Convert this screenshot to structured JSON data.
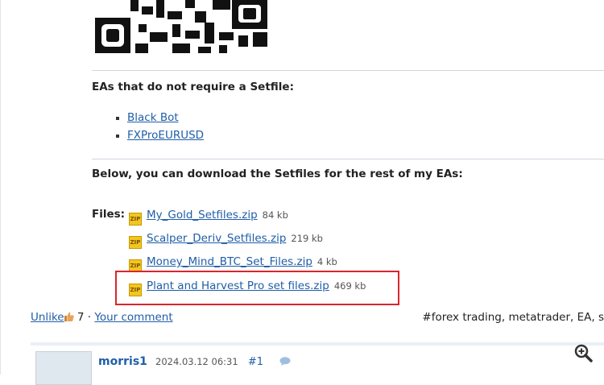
{
  "section_heading_1": "EAs that do not require a Setfile:",
  "no_setfile_eas": [
    "Black Bot",
    "FXProEURUSD"
  ],
  "section_heading_2": "Below, you can download the Setfiles for the rest of my EAs:",
  "files_label": "Files:",
  "files": [
    {
      "name": "My_Gold_Setfiles.zip",
      "size": "84 kb"
    },
    {
      "name": "Scalper_Deriv_Setfiles.zip",
      "size": "219 kb"
    },
    {
      "name": "Money_Mind_BTC_Set_Files.zip",
      "size": "4 kb"
    },
    {
      "name": "Plant and Harvest Pro set files.zip",
      "size": "469 kb"
    }
  ],
  "zip_icon_text": "ZIP",
  "footer": {
    "unlike": "Unlike",
    "like_count": "7",
    "separator": "·",
    "comment": "Your comment",
    "tags": "#forex trading, metatrader, EA, s"
  },
  "next_post": {
    "author": "morris1",
    "timestamp": "2024.03.12 06:31",
    "post_number": "#1"
  },
  "colors": {
    "link": "#1f5ea8",
    "highlight_border": "#d9262c",
    "zip_icon": "#f2c61f"
  }
}
